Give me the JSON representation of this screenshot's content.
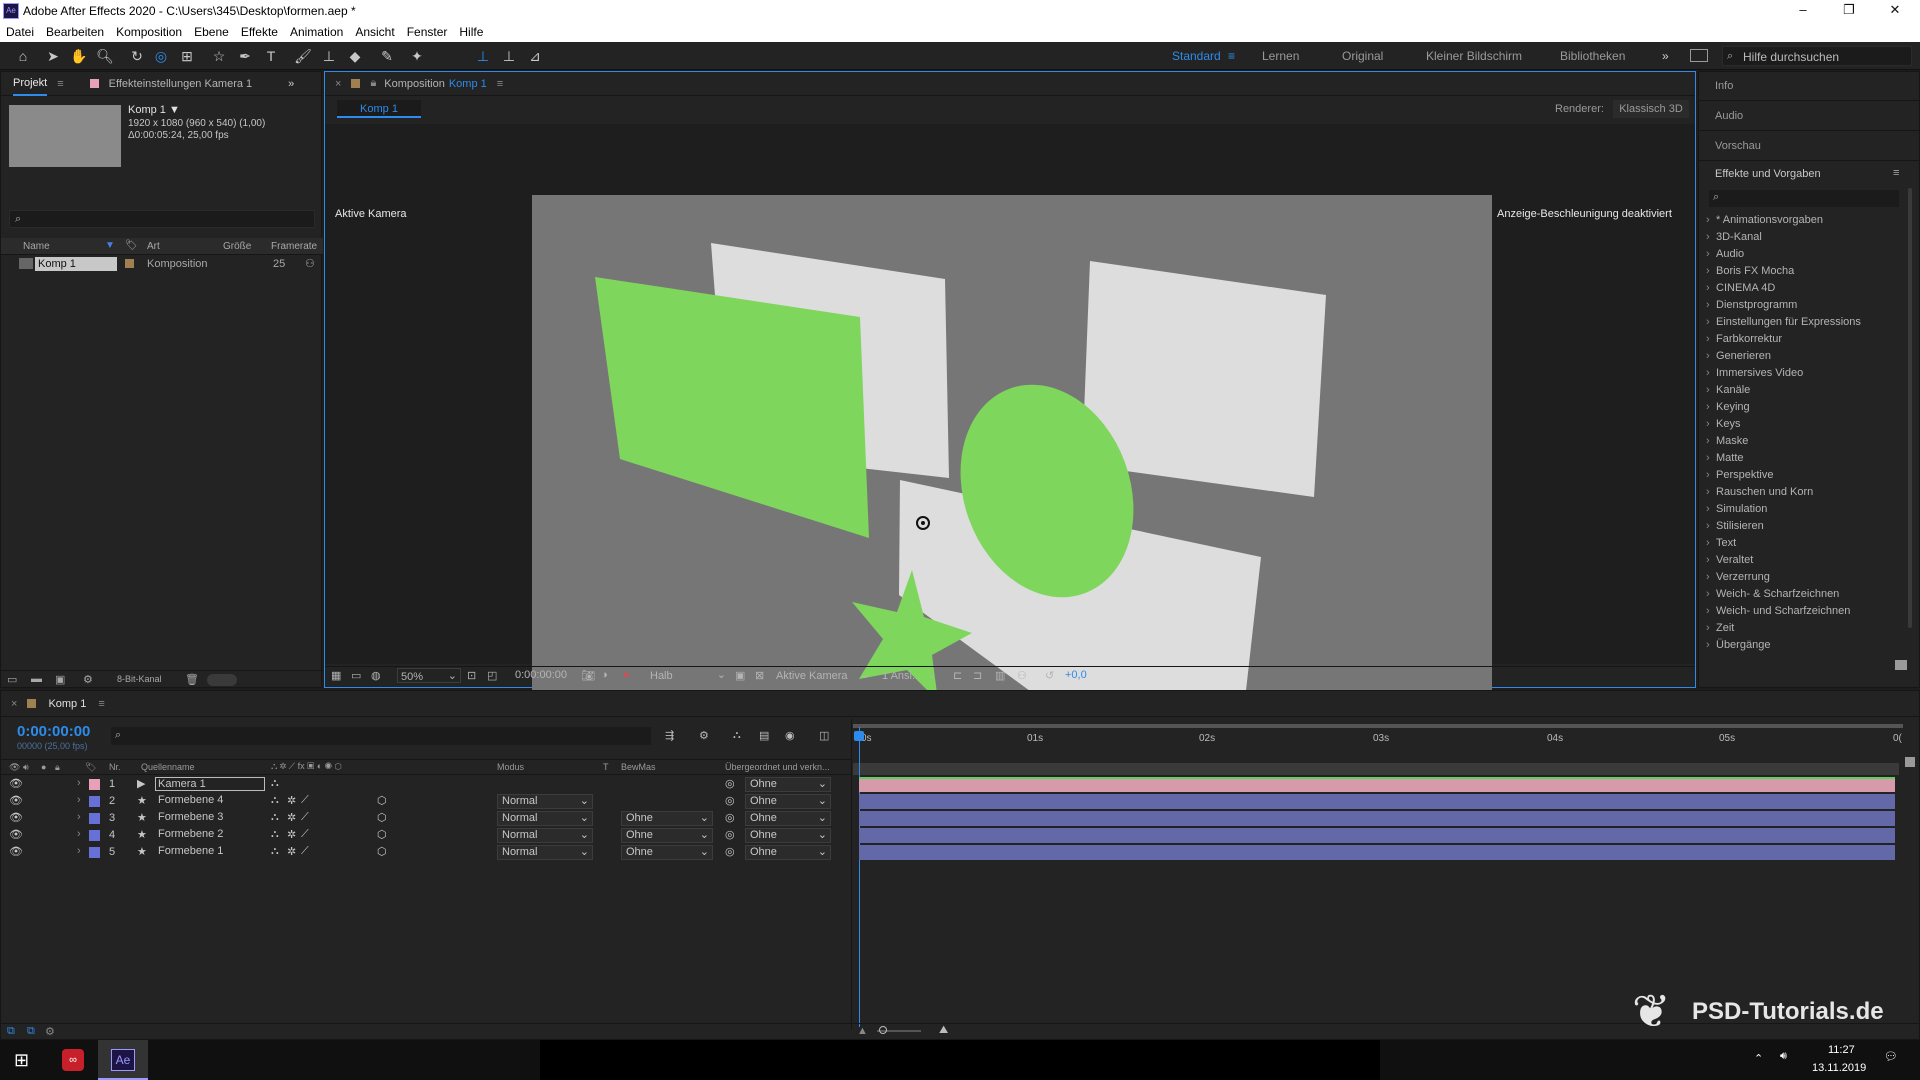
{
  "titlebar": {
    "title": "Adobe After Effects 2020 - C:\\Users\\345\\Desktop\\formen.aep *",
    "app_icon": "Ae"
  },
  "menu": [
    "Datei",
    "Bearbeiten",
    "Komposition",
    "Ebene",
    "Effekte",
    "Animation",
    "Ansicht",
    "Fenster",
    "Hilfe"
  ],
  "workspaces": {
    "standard": "Standard",
    "lernen": "Lernen",
    "original": "Original",
    "kleiner": "Kleiner Bildschirm",
    "bibliotheken": "Bibliotheken",
    "help": "Hilfe durchsuchen"
  },
  "project": {
    "tab": "Projekt",
    "tab2": "Effekteinstellungen Kamera 1",
    "comp_name": "Komp 1 ▼",
    "comp_info1": "1920 x 1080 (960 x 540) (1,00)",
    "comp_info2": "Δ0:00:05:24, 25,00 fps",
    "cols": [
      "Name",
      "Art",
      "Größe",
      "Framerate"
    ],
    "row_name": "Komp 1",
    "row_type": "Komposition",
    "row_fps": "25",
    "bitdepth": "8-Bit-Kanal"
  },
  "comp": {
    "header": "Komposition",
    "header_link": "Komp 1",
    "subtab": "Komp 1",
    "renderer_lbl": "Renderer:",
    "renderer": "Klassisch 3D",
    "active_cam": "Aktive Kamera",
    "accel": "Anzeige-Beschleunigung deaktiviert",
    "zoom": "50%",
    "time": "0:00:00:00",
    "quality": "Halb",
    "camera": "Aktive Kamera",
    "views": "1 Ansi...",
    "exposure": "+0,0"
  },
  "right": {
    "info": "Info",
    "audio": "Audio",
    "preview": "Vorschau",
    "effects": "Effekte und Vorgaben",
    "items": [
      "* Animationsvorgaben",
      "3D-Kanal",
      "Audio",
      "Boris FX Mocha",
      "CINEMA 4D",
      "Dienstprogramm",
      "Einstellungen für Expressions",
      "Farbkorrektur",
      "Generieren",
      "Immersives Video",
      "Kanäle",
      "Keying",
      "Keys",
      "Maske",
      "Matte",
      "Perspektive",
      "Rauschen und Korn",
      "Simulation",
      "Stilisieren",
      "Text",
      "Veraltet",
      "Verzerrung",
      "Weich- & Scharfzeichnen",
      "Weich- und Scharfzeichnen",
      "Zeit",
      "Übergänge"
    ]
  },
  "timeline": {
    "tab": "Komp 1",
    "timecode": "0:00:00:00",
    "fps": "00000 (25,00 fps)",
    "cols": {
      "nr": "Nr.",
      "source": "Quellenname",
      "mode": "Modus",
      "t": "T",
      "trkmat": "BewMas",
      "parent": "Übergeordnet und verkn..."
    },
    "ruler": [
      "0s",
      "01s",
      "02s",
      "03s",
      "04s",
      "05s",
      "0("
    ],
    "layers": [
      {
        "nr": "1",
        "name": "Kamera 1",
        "mode": "",
        "mat": "",
        "parent": "Ohne",
        "color": "#e8a0b8",
        "bar": "#d79aaa"
      },
      {
        "nr": "2",
        "name": "Formebene 4",
        "mode": "Normal",
        "mat": "",
        "parent": "Ohne",
        "color": "#6670d6",
        "bar": "#6368a8"
      },
      {
        "nr": "3",
        "name": "Formebene 3",
        "mode": "Normal",
        "mat": "Ohne",
        "parent": "Ohne",
        "color": "#6670d6",
        "bar": "#6368a8"
      },
      {
        "nr": "4",
        "name": "Formebene 2",
        "mode": "Normal",
        "mat": "Ohne",
        "parent": "Ohne",
        "color": "#6670d6",
        "bar": "#6368a8"
      },
      {
        "nr": "5",
        "name": "Formebene 1",
        "mode": "Normal",
        "mat": "Ohne",
        "parent": "Ohne",
        "color": "#6670d6",
        "bar": "#6368a8"
      }
    ]
  },
  "taskbar": {
    "time": "11:27",
    "date": "13.11.2019",
    "ae": "Ae"
  },
  "watermark": "PSD-Tutorials.de",
  "colors": {
    "accent": "#2d8ceb",
    "green": "#7fd65c",
    "shape": "#dddddd",
    "canvas": "#767676"
  }
}
